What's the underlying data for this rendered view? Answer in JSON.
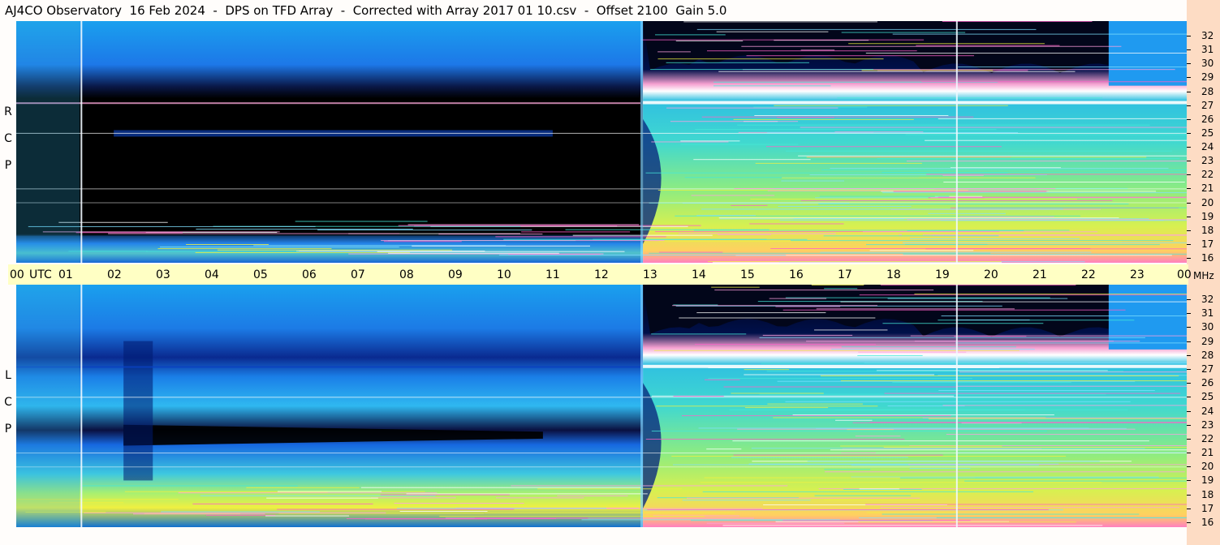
{
  "title": "AJ4CO Observatory  16 Feb 2024  -  DPS on TFD Array  -  Corrected with Array 2017 01 10.csv  -  Offset 2100  Gain 5.0",
  "panels": [
    {
      "name": "rcp",
      "letters": [
        "R",
        "C",
        "P"
      ]
    },
    {
      "name": "lcp",
      "letters": [
        "L",
        "C",
        "P"
      ]
    }
  ],
  "utc_label": "UTC",
  "mhz_label": "MHz",
  "chart_data": {
    "type": "heatmap",
    "title": "AJ4CO Observatory  16 Feb 2024  -  DPS on TFD Array  -  Corrected with Array 2017 01 10.csv  -  Offset 2100  Gain 5.0",
    "xlabel": "UTC",
    "ylabel": "MHz",
    "x_ticks": [
      "00",
      "01",
      "02",
      "03",
      "04",
      "05",
      "06",
      "07",
      "08",
      "09",
      "10",
      "11",
      "12",
      "13",
      "14",
      "15",
      "16",
      "17",
      "18",
      "19",
      "20",
      "21",
      "22",
      "23",
      "00"
    ],
    "y_ticks": [
      "32",
      "31",
      "30",
      "29",
      "28",
      "27",
      "26",
      "25",
      "24",
      "23",
      "22",
      "21",
      "20",
      "19",
      "18",
      "17",
      "16"
    ],
    "xlim": [
      0,
      24
    ],
    "ylim": [
      16,
      32
    ],
    "series": [
      {
        "name": "RCP"
      },
      {
        "name": "LCP"
      }
    ],
    "colormap": [
      "#000000",
      "#0a1f7a",
      "#1e6fe8",
      "#3aa6f0",
      "#46e8d8",
      "#a8f070",
      "#f0f040",
      "#ff6fd0",
      "#ffffff"
    ]
  }
}
